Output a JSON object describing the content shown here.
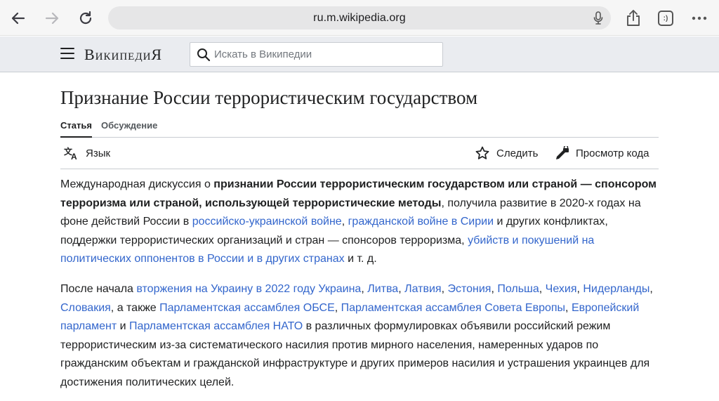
{
  "browser": {
    "url": "ru.m.wikipedia.org",
    "tab_count": ":)"
  },
  "header": {
    "wordmark": "ВикипедиЯ",
    "search_placeholder": "Искать в Википедии"
  },
  "article": {
    "title": "Признание России террористическим государством",
    "tabs": [
      {
        "label": "Статья",
        "active": true
      },
      {
        "label": "Обсуждение",
        "active": false
      }
    ],
    "toolbar": {
      "language": "Язык",
      "watch": "Следить",
      "view_source": "Просмотр кода"
    },
    "paragraph1": [
      {
        "t": "text",
        "v": "Международная дискуссия о "
      },
      {
        "t": "bold",
        "v": "признании России террористическим государством или страной — спонсором терроризма или страной, использующей террористические методы"
      },
      {
        "t": "text",
        "v": ", получила развитие в 2020-х годах на фоне действий России в "
      },
      {
        "t": "link",
        "v": "российско-украинской войне"
      },
      {
        "t": "text",
        "v": ", "
      },
      {
        "t": "link",
        "v": "гражданской войне в Сирии"
      },
      {
        "t": "text",
        "v": " и других конфликтах, поддержки террористических организаций и стран — спонсоров терроризма, "
      },
      {
        "t": "link",
        "v": "убийств и покушений на политических оппонентов в России и в других странах"
      },
      {
        "t": "text",
        "v": " и т. д."
      }
    ],
    "paragraph2": [
      {
        "t": "text",
        "v": "После начала "
      },
      {
        "t": "link",
        "v": "вторжения на Украину в 2022 году Украина"
      },
      {
        "t": "text",
        "v": ", "
      },
      {
        "t": "link",
        "v": "Литва"
      },
      {
        "t": "text",
        "v": ", "
      },
      {
        "t": "link",
        "v": "Латвия"
      },
      {
        "t": "text",
        "v": ", "
      },
      {
        "t": "link",
        "v": "Эстония"
      },
      {
        "t": "text",
        "v": ", "
      },
      {
        "t": "link",
        "v": "Польша"
      },
      {
        "t": "text",
        "v": ", "
      },
      {
        "t": "link",
        "v": "Чехия"
      },
      {
        "t": "text",
        "v": ", "
      },
      {
        "t": "link",
        "v": "Нидерланды"
      },
      {
        "t": "text",
        "v": ", "
      },
      {
        "t": "link",
        "v": "Словакия"
      },
      {
        "t": "text",
        "v": ", а также "
      },
      {
        "t": "link",
        "v": "Парламентская ассамблея ОБСЕ"
      },
      {
        "t": "text",
        "v": ", "
      },
      {
        "t": "link",
        "v": "Парламентская ассамблея Совета Европы"
      },
      {
        "t": "text",
        "v": ", "
      },
      {
        "t": "link",
        "v": "Европейский парламент"
      },
      {
        "t": "text",
        "v": " и "
      },
      {
        "t": "link",
        "v": "Парламентская ассамблея НАТО"
      },
      {
        "t": "text",
        "v": " в различных формулировках объявили российский режим террористическим из-за систематического насилия против мирного населения, намеренных ударов по гражданским объектам и гражданской инфраструктуре и других примеров насилия и устрашения украинцев для достижения политических целей."
      }
    ]
  }
}
